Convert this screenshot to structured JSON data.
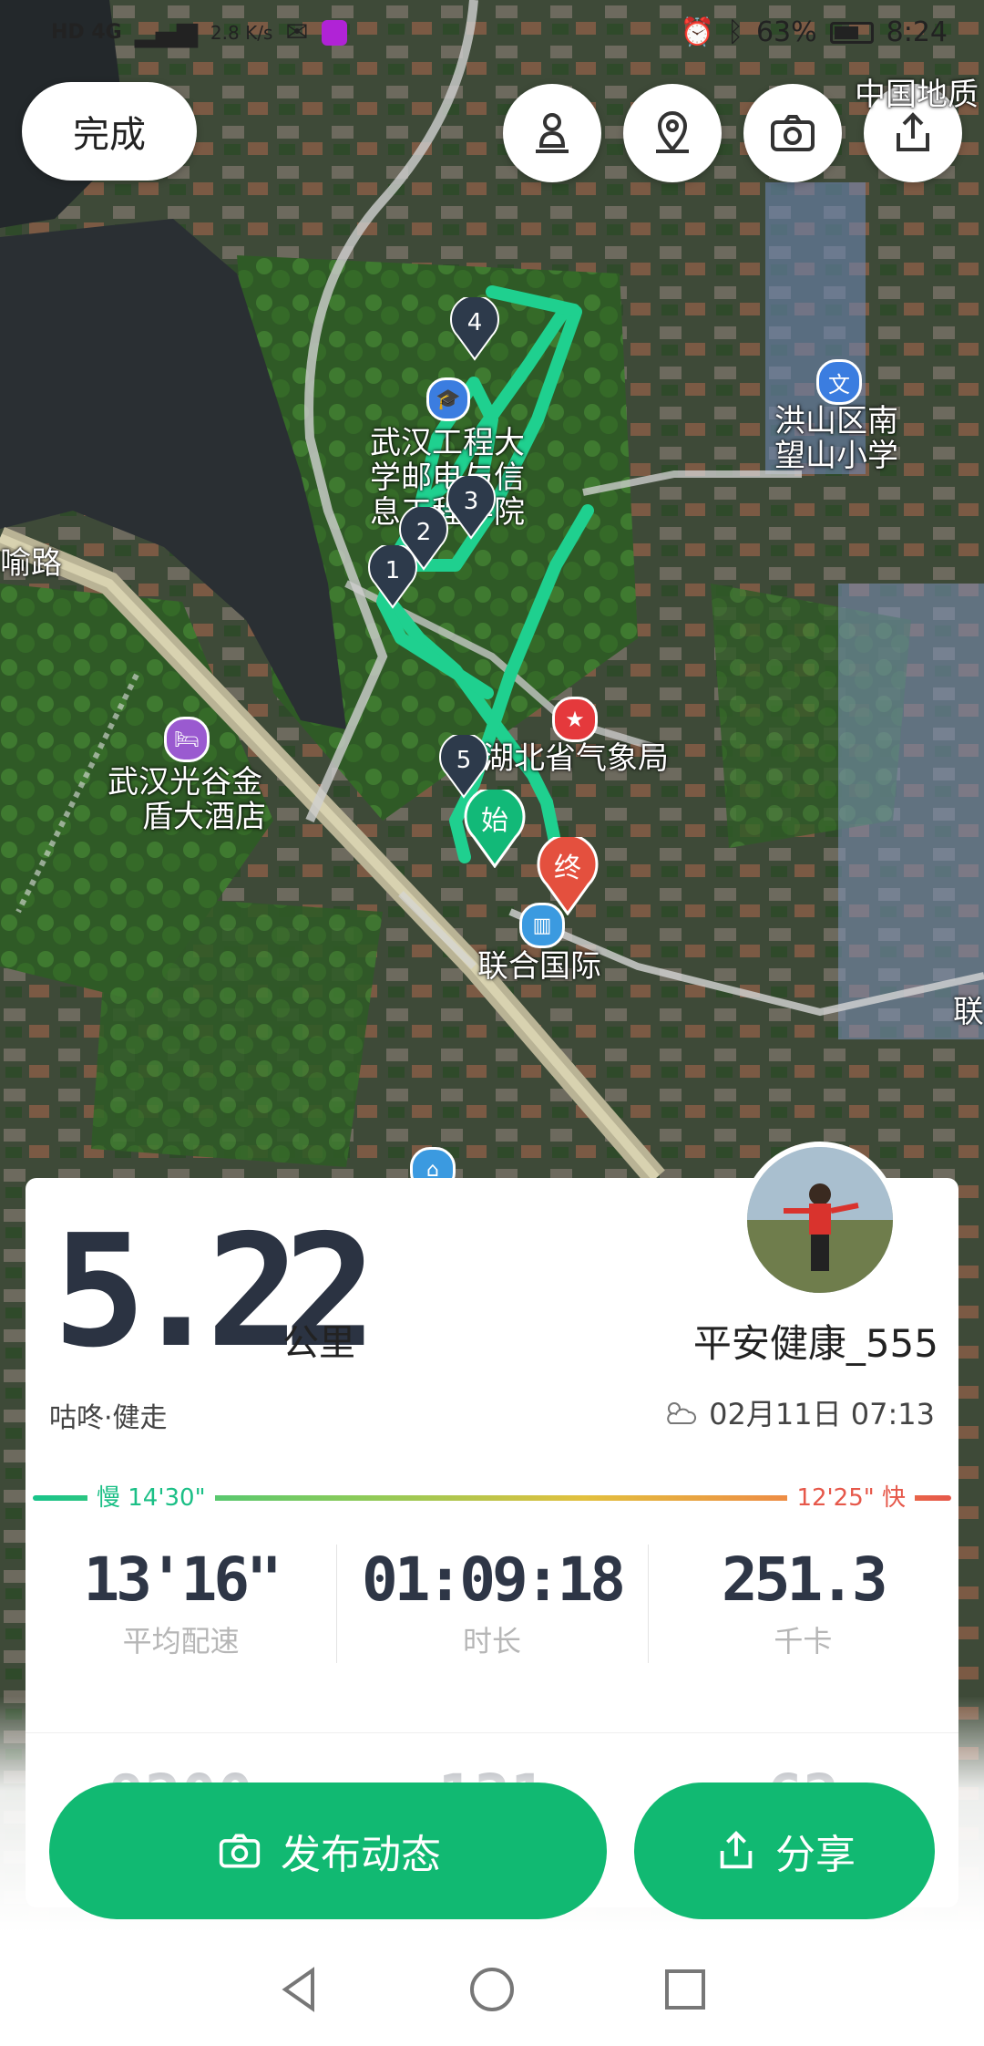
{
  "status_bar": {
    "network": "HD 4G",
    "speed": "2.8 K/s",
    "battery": "63%",
    "time": "8:24"
  },
  "toolbar": {
    "done_label": "完成"
  },
  "map": {
    "top_right_label": "中国地质",
    "labels": {
      "school": "武汉工程大学邮电与信息工程学院",
      "school_line1": "武汉工程大",
      "school_line2": "学邮电与信",
      "school_line3": "息工程学院",
      "primary_school_line1": "洪山区南",
      "primary_school_line2": "望山小学",
      "weather_bureau": "湖北省气象局",
      "hotel_line1": "武汉光谷金",
      "hotel_line2": "盾大酒店",
      "lianhe": "联合国际",
      "road_left": "喻路",
      "edge_right": "联"
    },
    "markers": [
      "1",
      "2",
      "3",
      "4",
      "5"
    ],
    "start_label": "始",
    "end_label": "终",
    "route_color": "#1fd08f"
  },
  "summary": {
    "distance": "5.22",
    "distance_unit": "公里",
    "username": "平安健康_555",
    "activity": "咕咚·健走",
    "datetime": "02月11日 07:13",
    "pace_slow": "慢 14'30\"",
    "pace_fast": "12'25\" 快",
    "stats": [
      {
        "value": "13'16\"",
        "label": "平均配速"
      },
      {
        "value": "01:09:18",
        "label": "时长"
      },
      {
        "value": "251.3",
        "label": "千卡"
      }
    ],
    "stats_row2": [
      "9200",
      "131",
      "62"
    ]
  },
  "actions": {
    "post_label": "发布动态",
    "share_label": "分享",
    "accent": "#11b972"
  }
}
